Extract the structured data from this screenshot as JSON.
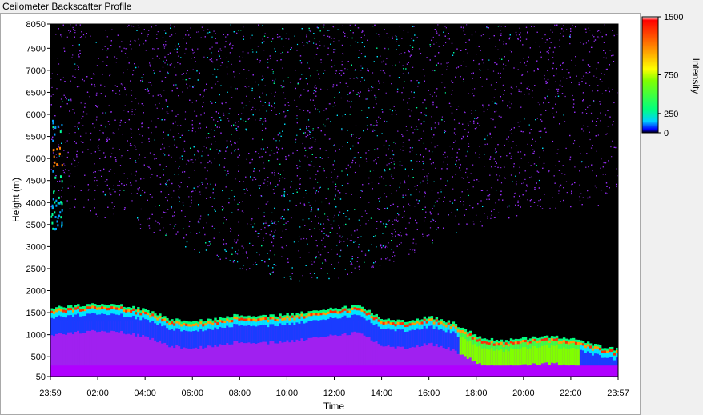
{
  "chart_data": {
    "type": "heatmap",
    "title": "Ceilometer Backscatter Profile",
    "xlabel": "Time",
    "ylabel": "Height (m)",
    "x_ticks": [
      "23:59",
      "02:00",
      "04:00",
      "06:00",
      "08:00",
      "10:00",
      "12:00",
      "14:00",
      "16:00",
      "18:00",
      "20:00",
      "22:00",
      "23:57"
    ],
    "y_ticks": [
      "50",
      "500",
      "1000",
      "1500",
      "2000",
      "2500",
      "3000",
      "3500",
      "4000",
      "4500",
      "5000",
      "5500",
      "6000",
      "6500",
      "7000",
      "7500",
      "8050"
    ],
    "ylim": [
      50,
      8050
    ],
    "colorbar": {
      "label": "Intensity",
      "ticks": [
        "0",
        "250",
        "750",
        "1500"
      ],
      "range": [
        0,
        1500
      ]
    },
    "layers": {
      "boundary_layer_top_m": [
        1550,
        1600,
        1650,
        1600,
        1500,
        1300,
        1250,
        1300,
        1400,
        1350,
        1400,
        1450,
        1550,
        1600,
        1300,
        1250,
        1350,
        1200,
        900,
        800,
        850,
        900,
        850,
        700,
        600
      ],
      "upper_noise_region_m": [
        3200,
        8050
      ]
    },
    "colors": {
      "background": "#000000",
      "low": "#8a2be2",
      "mid": "#00e5ff",
      "high": "#00ff00",
      "peak": "#ff0000"
    }
  }
}
